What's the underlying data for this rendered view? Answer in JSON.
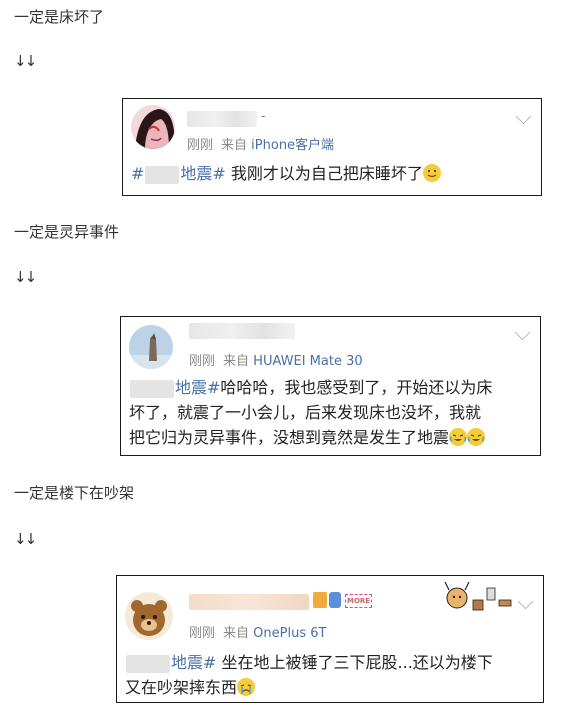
{
  "sections": [
    {
      "caption": "一定是床坏了",
      "arrows": "↓↓",
      "post": {
        "time": "刚刚",
        "source_prefix": "来自",
        "device": "iPhone客户端",
        "tag_open": "#",
        "tag_close": "地震#",
        "text": "我刚才以为自己把床睡坏了",
        "emoji": [
          "smile-emoji"
        ]
      }
    },
    {
      "caption": "一定是灵异事件",
      "arrows": "↓↓",
      "post": {
        "time": "刚刚",
        "source_prefix": "来自",
        "device": "HUAWEI Mate 30",
        "tag_close": "地震#",
        "text_line1": "哈哈哈，我也感受到了，开始还以为床",
        "text_line2": "坏了，就震了一小会儿，后来发现床也没坏，我就",
        "text_line3": "把它归为灵异事件，没想到竟然是发生了地震",
        "emoji": [
          "laugh-cry-emoji",
          "laugh-cry-emoji"
        ]
      }
    },
    {
      "caption": "一定是楼下在吵架",
      "arrows": "↓↓",
      "post": {
        "time": "刚刚",
        "source_prefix": "来自",
        "device": "OnePlus 6T",
        "tag_close": "地震#",
        "text_line1": "坐在地上被锤了三下屁股...还以为楼下",
        "text_line2": "又在吵架摔东西",
        "emoji": [
          "crying-emoji"
        ],
        "badge_text": "MORE"
      }
    }
  ],
  "colors": {
    "link": "#4a6fa5",
    "meta": "#8a8a8a",
    "border": "#1a1a1a"
  }
}
